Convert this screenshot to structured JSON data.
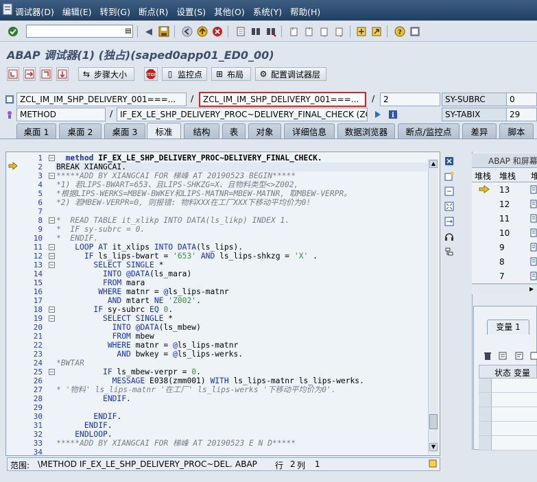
{
  "menubar": {
    "items": [
      "调试器(D)",
      "编辑(E)",
      "转到(G)",
      "断点(R)",
      "设置(S)",
      "其他(O)",
      "系统(Y)",
      "帮助(H)"
    ]
  },
  "toolbar": {
    "command_value": ""
  },
  "title": "ABAP 调试器(1) (独占)(saped0app01_ED0_00)",
  "toolbar2": {
    "step_size": "步骤大小",
    "watchpoint": "监控点",
    "layout": "布局",
    "config": "配置调试器层"
  },
  "fields": {
    "program": "ZCL_IM_IM_SHP_DELIVERY_001===...",
    "include": "ZCL_IM_IM_SHP_DELIVERY_001===...",
    "line": "2",
    "event_type": "METHOD",
    "event": "IF_EX_LE_SHP_DELIVERY_PROC~DELIVERY_FINAL_CHECK (ZCL...",
    "sy_subrc_label": "SY-SUBRC",
    "sy_subrc_value": "0",
    "sy_tabix_label": "SY-TABIX",
    "sy_tabix_value": "29"
  },
  "tabs": [
    "桌面 1",
    "桌面 2",
    "桌面 3",
    "标准",
    "结构",
    "表",
    "对象",
    "详细信息",
    "数据浏览器",
    "断点/监控点",
    "差异",
    "脚本"
  ],
  "active_tab": "标准",
  "code_lines": [
    {
      "n": "1",
      "t": "  method IF_EX_LE_SHP_DELIVERY_PROC~DELIVERY_FINAL_CHECK."
    },
    {
      "n": "2",
      "t": "BREAK XIANGCAI."
    },
    {
      "n": "3",
      "t": "*****ADD BY XIANGCAI FOR 梯峰 AT 20190523 BEGIN*****"
    },
    {
      "n": "4",
      "t": "*1) 若LIPS-BWART=653、且LIPS-SHKZG=X、且物料类型<>Z002,"
    },
    {
      "n": "5",
      "t": "*根据LIPS-WERKS=MBEW-BWKEY和LIPS-MATNR=MBEW-MATNR, 取MBEW-VERPR。"
    },
    {
      "n": "6",
      "t": "*2) 若MBEW-VERPR=0, 则报错: 物料XXX在工厂XXX下移动平均价为0!"
    },
    {
      "n": "7",
      "t": ""
    },
    {
      "n": "8",
      "t": "*  READ TABLE it_xlikp INTO DATA(ls_likp) INDEX 1."
    },
    {
      "n": "9",
      "t": "*  IF sy-subrc = 0."
    },
    {
      "n": "10",
      "t": "*  ENDIF."
    },
    {
      "n": "11",
      "t": "    LOOP AT it_xlips INTO DATA(ls_lips)."
    },
    {
      "n": "12",
      "t": "      IF ls_lips-bwart = '653' AND ls_lips-shkzg = 'X' ."
    },
    {
      "n": "13",
      "t": "        SELECT SINGLE *"
    },
    {
      "n": "14",
      "t": "          INTO @DATA(ls_mara)"
    },
    {
      "n": "15",
      "t": "          FROM mara"
    },
    {
      "n": "16",
      "t": "         WHERE matnr = @ls_lips-matnr"
    },
    {
      "n": "17",
      "t": "           AND mtart NE 'Z002'."
    },
    {
      "n": "18",
      "t": "        IF sy-subrc EQ 0."
    },
    {
      "n": "19",
      "t": "          SELECT SINGLE *"
    },
    {
      "n": "20",
      "t": "            INTO @DATA(ls_mbew)"
    },
    {
      "n": "21",
      "t": "            FROM mbew"
    },
    {
      "n": "22",
      "t": "           WHERE matnr = @ls_lips-matnr"
    },
    {
      "n": "23",
      "t": "             AND bwkey = @ls_lips-werks."
    },
    {
      "n": "24",
      "t": "*BWTAR"
    },
    {
      "n": "25",
      "t": "          IF ls_mbew-verpr = 0."
    },
    {
      "n": "26",
      "t": "            MESSAGE E038(zmm001) WITH ls_lips-matnr ls_lips-werks."
    },
    {
      "n": "27",
      "t": "* '物料' ls_lips-matnr '在工厂' ls_lips-werks '下移动平均价为0'."
    },
    {
      "n": "28",
      "t": "          ENDIF."
    },
    {
      "n": "29",
      "t": ""
    },
    {
      "n": "30",
      "t": "        ENDIF."
    },
    {
      "n": "31",
      "t": "      ENDIF."
    },
    {
      "n": "32",
      "t": "    ENDLOOP."
    },
    {
      "n": "33",
      "t": "*****ADD BY XIANGCAI FOR 梯峰 AT 20190523 E N D*****"
    },
    {
      "n": "34",
      "t": ""
    }
  ],
  "status": {
    "scope_label": "范围:",
    "scope_value": "\\METHOD IF_EX_LE_SHP_DELIVERY_PROC~DEL...",
    "lang": "ABAP",
    "pos_label": "行",
    "line": "2",
    "col_label": "列",
    "col": "1"
  },
  "right_panel": {
    "header": "ABAP 和屏幕",
    "col1": "堆栈",
    "col2": "堆栈",
    "col3": "堆",
    "rows": [
      "13",
      "12",
      "11",
      "10",
      "9",
      "8",
      "7"
    ],
    "var_tab": "变量 1",
    "var_col1": "状态",
    "var_col2": "变量"
  }
}
